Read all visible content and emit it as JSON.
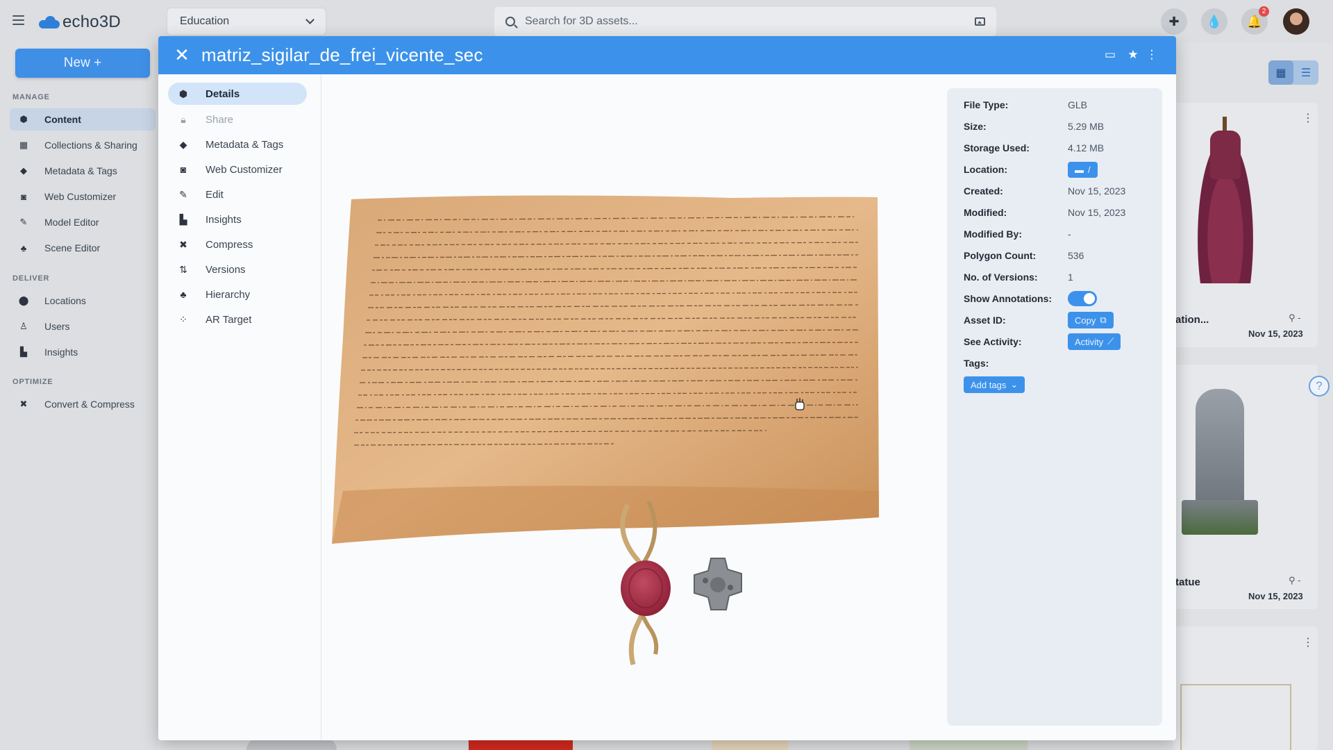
{
  "app": {
    "logo_text": "echo3D"
  },
  "topbar": {
    "workspace": "Education",
    "search_placeholder": "Search for 3D assets...",
    "notification_count": "2",
    "icons": [
      "puzzle-icon",
      "droplet-icon",
      "bell-icon",
      "avatar"
    ]
  },
  "sidebar": {
    "new_button": "New +",
    "sections": {
      "manage": "MANAGE",
      "deliver": "DELIVER",
      "optimize": "OPTIMIZE"
    },
    "manage_items": [
      {
        "label": "Content",
        "icon": "cube-icon",
        "active": true
      },
      {
        "label": "Collections & Sharing",
        "icon": "grid-icon"
      },
      {
        "label": "Metadata & Tags",
        "icon": "tag-icon"
      },
      {
        "label": "Web Customizer",
        "icon": "vr-glasses-icon"
      },
      {
        "label": "Model Editor",
        "icon": "pencil-icon"
      },
      {
        "label": "Scene Editor",
        "icon": "shapes-icon"
      }
    ],
    "deliver_items": [
      {
        "label": "Locations",
        "icon": "location-pin-icon"
      },
      {
        "label": "Users",
        "icon": "user-icon"
      },
      {
        "label": "Insights",
        "icon": "chart-icon"
      }
    ],
    "optimize_items": [
      {
        "label": "Convert & Compress",
        "icon": "compress-icon"
      }
    ]
  },
  "background_cards": [
    {
      "title": "ation...",
      "date": "Nov 15, 2023",
      "count": "-"
    },
    {
      "title": "tatue",
      "date": "Nov 15, 2023",
      "count": "-"
    }
  ],
  "modal": {
    "title": "matriz_sigilar_de_frei_vicente_sec",
    "nav": [
      {
        "label": "Details",
        "icon": "cube-icon",
        "active": true
      },
      {
        "label": "Share",
        "icon": "lock-icon",
        "disabled": true
      },
      {
        "label": "Metadata & Tags",
        "icon": "tag-icon"
      },
      {
        "label": "Web Customizer",
        "icon": "vr-glasses-icon"
      },
      {
        "label": "Edit",
        "icon": "pencil-icon"
      },
      {
        "label": "Insights",
        "icon": "chart-icon"
      },
      {
        "label": "Compress",
        "icon": "compress-icon"
      },
      {
        "label": "Versions",
        "icon": "versions-icon"
      },
      {
        "label": "Hierarchy",
        "icon": "hierarchy-icon"
      },
      {
        "label": "AR Target",
        "icon": "ar-target-icon"
      }
    ],
    "details": {
      "file_type_label": "File Type:",
      "file_type": "GLB",
      "size_label": "Size:",
      "size": "5.29 MB",
      "storage_label": "Storage Used:",
      "storage": "4.12 MB",
      "location_label": "Location:",
      "location": "/",
      "created_label": "Created:",
      "created": "Nov 15, 2023",
      "modified_label": "Modified:",
      "modified": "Nov 15, 2023",
      "modified_by_label": "Modified By:",
      "modified_by": "-",
      "polygon_label": "Polygon Count:",
      "polygon": "536",
      "versions_label": "No. of Versions:",
      "versions": "1",
      "annotations_label": "Show Annotations:",
      "annotations_on": true,
      "asset_id_label": "Asset ID:",
      "asset_id_button": "Copy",
      "activity_label": "See Activity:",
      "activity_button": "Activity",
      "tags_label": "Tags:",
      "add_tags_button": "Add tags"
    }
  },
  "colors": {
    "accent": "#3c92ea",
    "seal": "#a8304a"
  }
}
